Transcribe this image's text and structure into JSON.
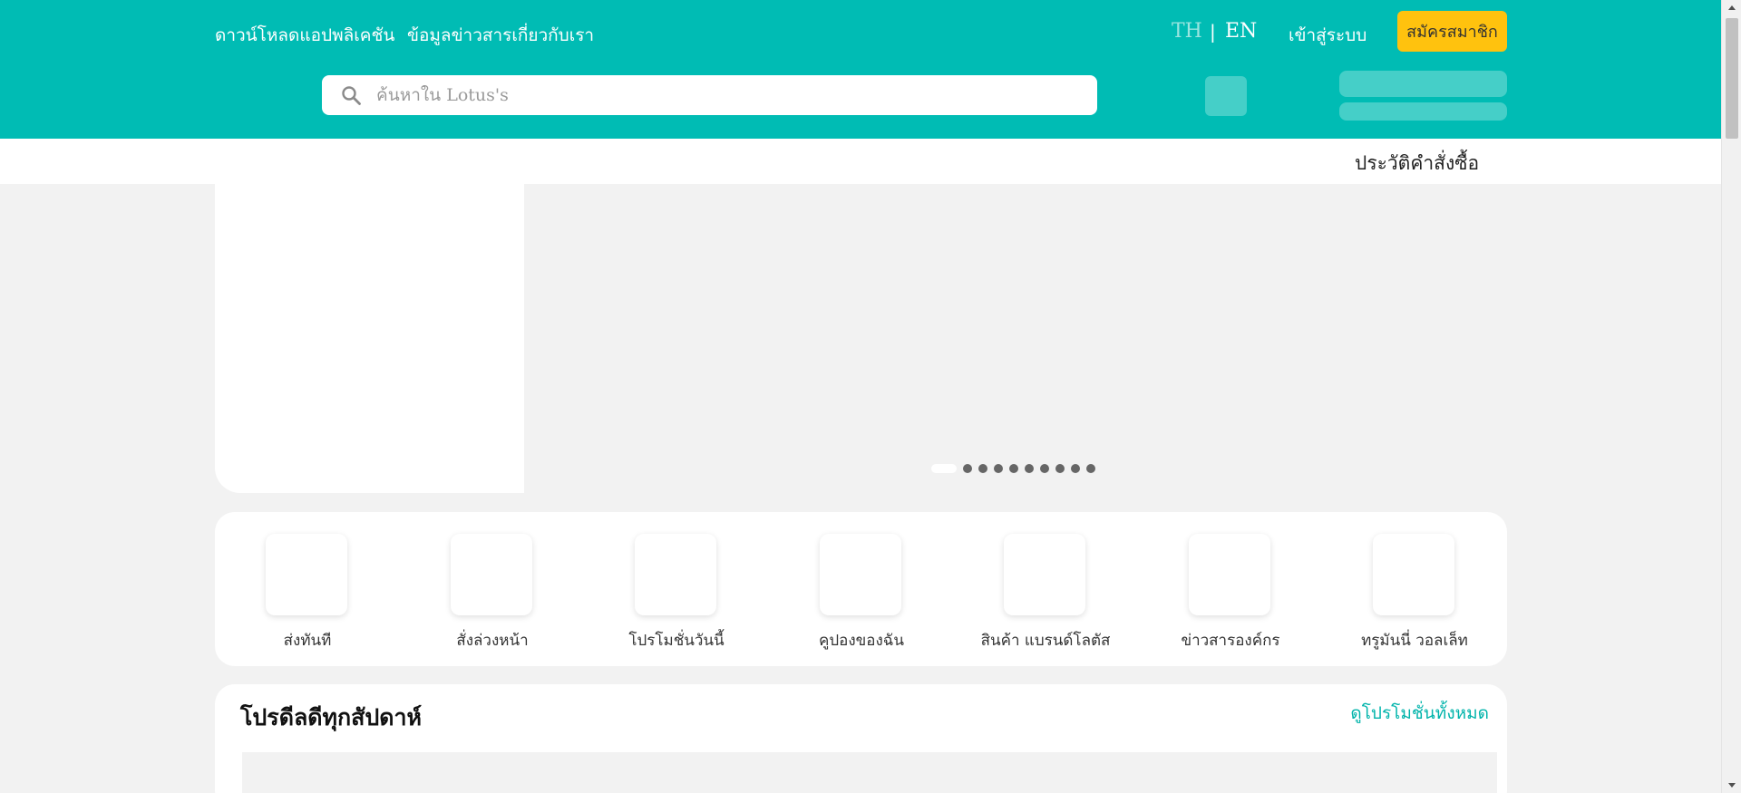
{
  "header": {
    "download_app": "ดาวน์โหลดแอปพลิเคชัน",
    "about_news": "ข้อมูลข่าวสารเกี่ยวกับเรา",
    "lang_th": "TH",
    "lang_separator": "|",
    "lang_en": "EN",
    "login": "เข้าสู่ระบบ",
    "signup": "สมัครสมาชิก"
  },
  "search": {
    "placeholder": "ค้นหาใน Lotus's",
    "value": ""
  },
  "subnav": {
    "order_history": "ประวัติคำสั่งซื้อ"
  },
  "hero": {
    "slide_count": 10,
    "active_slide": 1
  },
  "categories": [
    {
      "label": "ส่งทันที"
    },
    {
      "label": "สั่งล่วงหน้า"
    },
    {
      "label": "โปรโมชั่นวันนี้"
    },
    {
      "label": "คูปองของฉัน"
    },
    {
      "label": "สินค้า แบรนด์โลตัส"
    },
    {
      "label": "ข่าวสารองค์กร"
    },
    {
      "label": "ทรูมันนี่ วอลเล็ท"
    }
  ],
  "promo": {
    "title": "โปรดีลดีทุกสัปดาห์",
    "see_all": "ดูโปรโมชั่นทั้งหมด"
  },
  "colors": {
    "brand": "#00bcb4",
    "signup_button": "#ffc20e",
    "link": "#00b4ab",
    "background": "#f2f2f2"
  },
  "icons": {
    "search": "search-icon"
  }
}
